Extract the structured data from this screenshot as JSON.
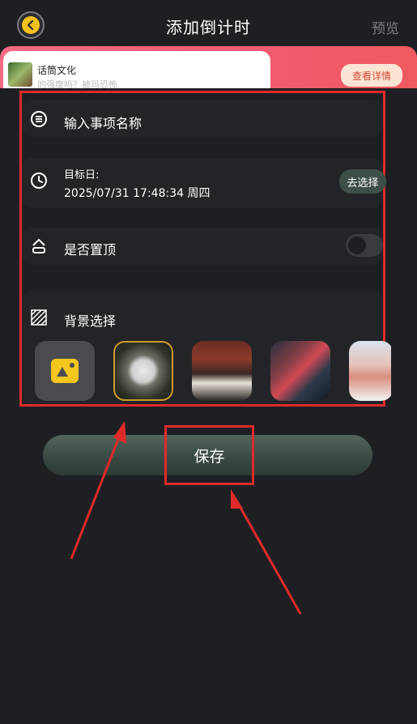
{
  "header": {
    "title": "添加倒计时",
    "preview_label": "预览",
    "back_icon": "chevron-left-icon"
  },
  "ad": {
    "title": "话筒文化",
    "subtitle": "的强度吗？被玛恐怖",
    "detail_label": "查看详情"
  },
  "form": {
    "event_name_placeholder": "输入事项名称",
    "target_date_label": "目标日:",
    "target_date_value": "2025/07/31 17:48:34 周四",
    "choose_label": "去选择",
    "pin_top_label": "是否置顶",
    "pin_top_enabled": false,
    "background_label": "背景选择",
    "backgrounds": [
      {
        "name": "camera-upload",
        "selected": false
      },
      {
        "name": "dandelion",
        "selected": true
      },
      {
        "name": "coffee",
        "selected": false
      },
      {
        "name": "city-bridge",
        "selected": false
      },
      {
        "name": "building",
        "selected": false
      }
    ]
  },
  "save_label": "保存",
  "colors": {
    "background": "#1e1f23",
    "annotation_red": "#e02a2a",
    "accent_yellow": "#f3c21a",
    "save_green": "#3b4a44"
  }
}
